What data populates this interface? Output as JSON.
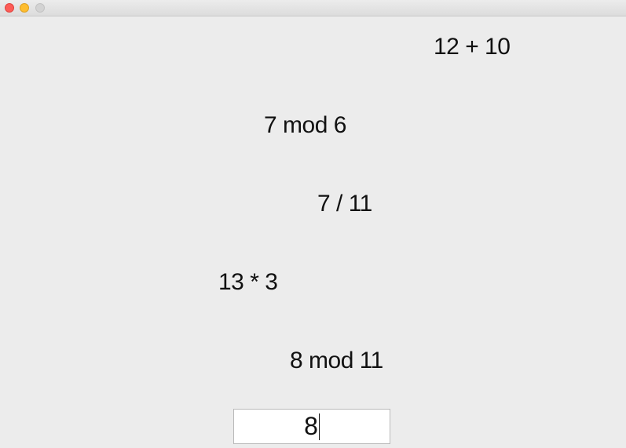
{
  "window": {
    "controls": [
      "close-button",
      "minimize-button",
      "zoom-button"
    ]
  },
  "problems": [
    {
      "text": "12 + 10"
    },
    {
      "text": "7 mod 6"
    },
    {
      "text": "7 / 11"
    },
    {
      "text": "13 * 3"
    },
    {
      "text": "8 mod 11"
    }
  ],
  "answer": {
    "value": "8"
  }
}
